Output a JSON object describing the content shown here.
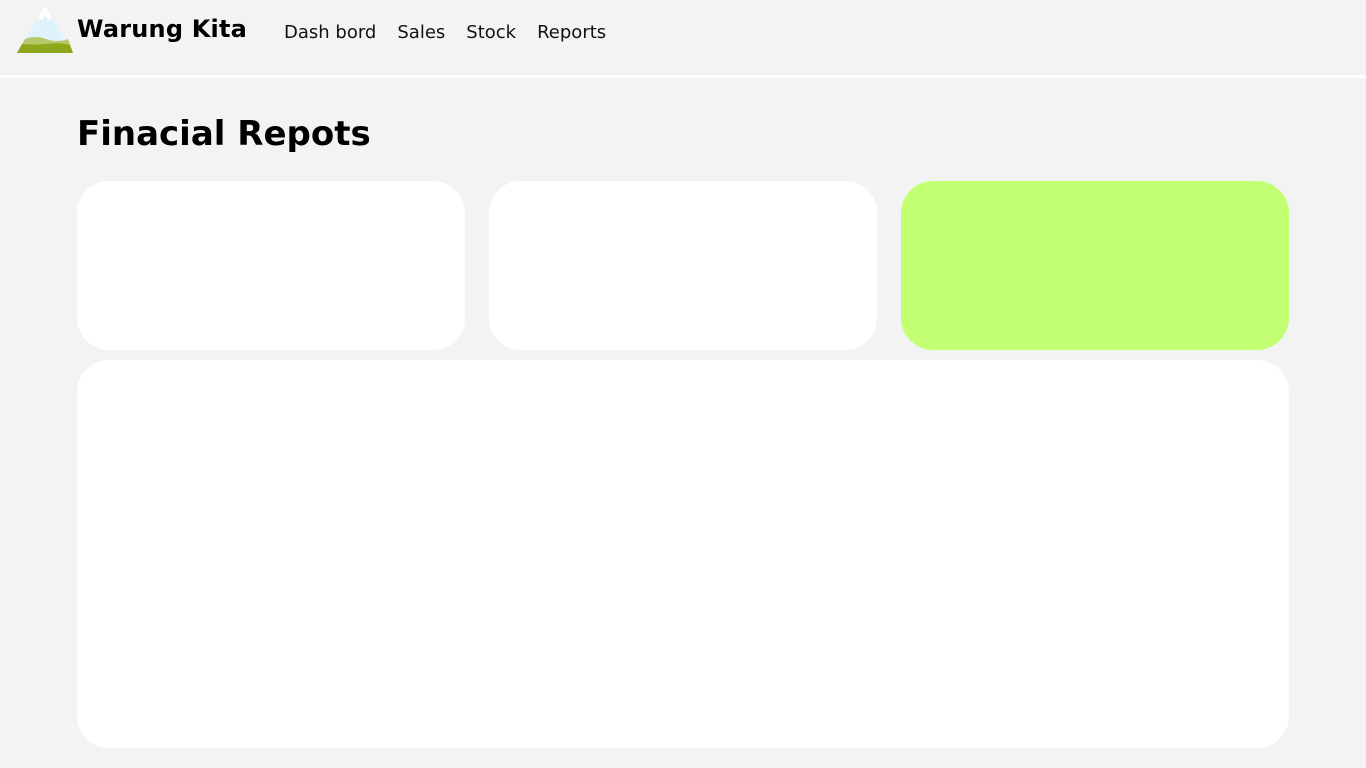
{
  "brand": {
    "name": "Warung Kita",
    "logo_icon": "mountain-icon"
  },
  "nav": {
    "items": [
      {
        "label": "Dash bord"
      },
      {
        "label": "Sales"
      },
      {
        "label": "Stock"
      },
      {
        "label": "Reports"
      }
    ]
  },
  "page": {
    "title": "Finacial Repots"
  },
  "colors": {
    "background": "#f3f3f3",
    "card": "#ffffff",
    "accent_card": "#c3ff73",
    "logo_sky": "#dff3fb",
    "logo_hill": "#8ea81d"
  }
}
